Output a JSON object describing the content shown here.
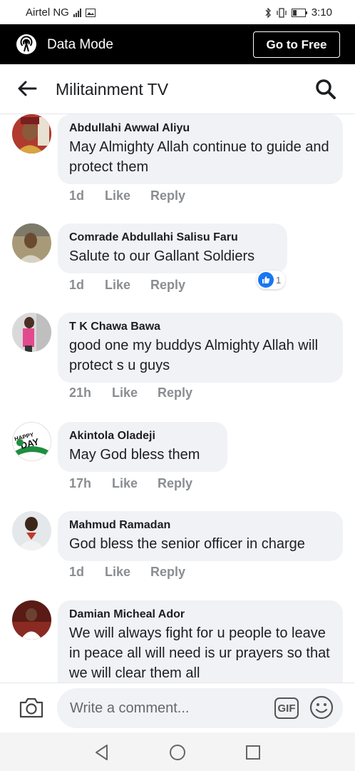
{
  "status_bar": {
    "carrier": "Airtel NG",
    "time": "3:10"
  },
  "data_mode": {
    "label": "Data Mode",
    "button": "Go to Free"
  },
  "header": {
    "title": "Militainment TV"
  },
  "comments": [
    {
      "author": "Abdullahi Awwal Aliyu",
      "text": "May Almighty Allah continue to guide and protect them",
      "time": "1d",
      "like": "Like",
      "reply": "Reply"
    },
    {
      "author": "Comrade Abdullahi Salisu Faru",
      "text": "Salute to our Gallant Soldiers",
      "time": "1d",
      "like": "Like",
      "reply": "Reply",
      "reaction_count": "1"
    },
    {
      "author": "T K Chawa Bawa",
      "text": "good one my buddys Almighty Allah will protect s u guys",
      "time": "21h",
      "like": "Like",
      "reply": "Reply"
    },
    {
      "author": "Akintola Oladeji",
      "text": "May God bless them",
      "time": "17h",
      "like": "Like",
      "reply": "Reply",
      "avatar_text": "HAPPY INDEPENDENCE DAY"
    },
    {
      "author": "Mahmud Ramadan",
      "text": "God bless the senior officer in charge",
      "time": "1d",
      "like": "Like",
      "reply": "Reply"
    },
    {
      "author": "Damian Micheal Ador",
      "text": "We will always fight for u people to leave in peace all will need is ur prayers so that we will clear them all",
      "time": "",
      "like": "",
      "reply": ""
    }
  ],
  "composer": {
    "placeholder": "Write a comment...",
    "gif_label": "GIF"
  },
  "colors": {
    "accent": "#1877f2",
    "bubble": "#f0f2f5",
    "meta_text": "#8a8d91",
    "data_bar": "#000000"
  },
  "icons": [
    "signal-icon",
    "battery-icon",
    "data-mode-icon",
    "back-arrow-icon",
    "search-icon",
    "like-reaction-icon",
    "camera-icon",
    "gif-icon",
    "emoji-icon",
    "nav-back-icon",
    "nav-home-icon",
    "nav-recents-icon"
  ]
}
